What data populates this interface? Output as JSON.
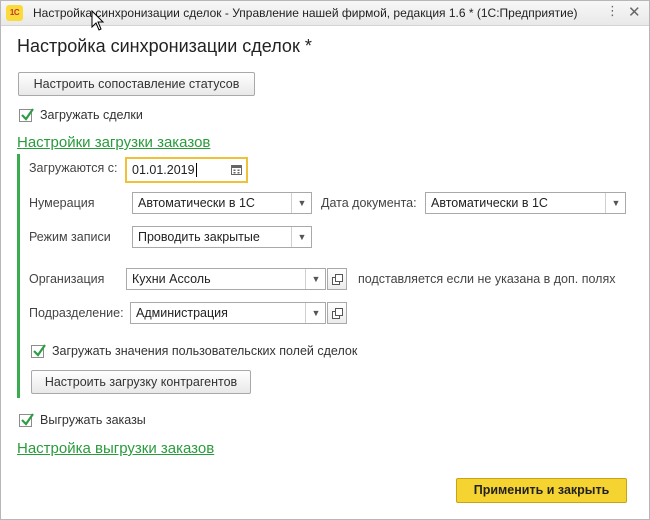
{
  "window": {
    "logo": "1С",
    "title": "Настройка синхронизации сделок - Управление нашей фирмой, редакция 1.6 *  (1С:Предприятие)",
    "more_glyph": "⋮",
    "close_glyph": "✕"
  },
  "form": {
    "title": "Настройка синхронизации сделок *",
    "map_statuses_button": "Настроить сопоставление статусов",
    "load_deals": {
      "label": "Загружать сделки",
      "checked": true
    },
    "load_settings_link": "Настройки загрузки заказов",
    "load_group": {
      "date_from": {
        "label": "Загружаются с:",
        "value": "01.01.2019"
      },
      "numbering": {
        "label": "Нумерация",
        "value": "Автоматически в 1С"
      },
      "doc_date": {
        "label": "Дата документа:",
        "value": "Автоматически в 1С"
      },
      "write_mode": {
        "label": "Режим записи",
        "value": "Проводить закрытые"
      },
      "organization": {
        "label": "Организация",
        "value": "Кухни Ассоль",
        "note": "подставляется если не указана в доп. полях"
      },
      "division": {
        "label": "Подразделение:",
        "value": "Администрация"
      },
      "load_custom_fields": {
        "label": "Загружать значения пользовательских полей сделок",
        "checked": true
      },
      "contractors_button": "Настроить загрузку контрагентов"
    },
    "upload_orders": {
      "label": "Выгружать заказы",
      "checked": true
    },
    "upload_settings_link": "Настройка выгрузки заказов",
    "apply_button": "Применить и закрыть"
  },
  "colors": {
    "link_green": "#2a9b3c",
    "group_bar": "#3bab4f",
    "apply_yellow": "#f5d330",
    "focus_border": "#f0c038"
  }
}
